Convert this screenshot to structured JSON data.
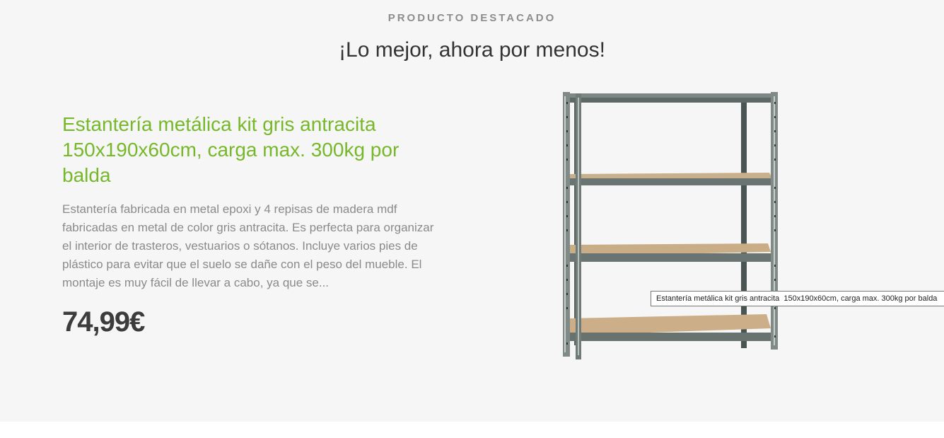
{
  "section": {
    "eyebrow": "PRODUCTO DESTACADO",
    "headline": "¡Lo mejor, ahora por menos!"
  },
  "product": {
    "title": "Estantería metálica kit gris antracita 150x190x60cm, carga max. 300kg por balda",
    "description": "Estantería fabricada en metal epoxi y 4 repisas de madera mdf fabricadas en metal de color gris antracita. Es perfecta para organizar el interior de trasteros, vestuarios o sótanos. Incluye varios pies de plástico para evitar que el suelo se dañe con el peso del mueble. El montaje es muy fácil de llevar a cabo, ya que se...",
    "price": "74,99€",
    "image_tooltip": "Estantería metálica kit gris antracita  150x190x60cm, carga max. 300kg por balda"
  },
  "colors": {
    "accent_green": "#76b82a",
    "background": "#f6f6f6",
    "text_muted": "#8a8a8a",
    "price": "#3c3c3c"
  }
}
